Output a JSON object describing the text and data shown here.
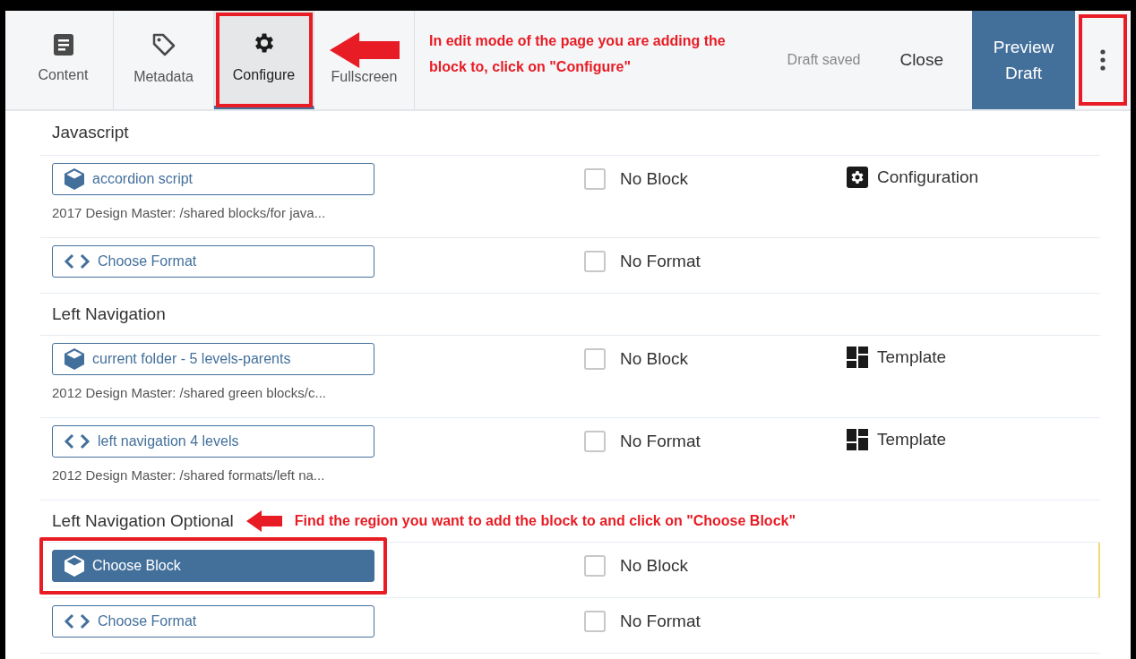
{
  "tabs": [
    {
      "label": "Content",
      "selected": false,
      "annotated": false
    },
    {
      "label": "Metadata",
      "selected": false,
      "annotated": false
    },
    {
      "label": "Configure",
      "selected": true,
      "annotated": true
    },
    {
      "label": "Fullscreen",
      "selected": false,
      "annotated": false
    }
  ],
  "toolbar_annotation": "In edit mode of the page you are adding the block to, click on \"Configure\"",
  "draft_status": "Draft saved",
  "close_button": "Close",
  "preview_button": "Preview Draft",
  "more_menu": {
    "annotated": true
  },
  "sections": [
    {
      "title": "Javascript",
      "rows": [
        {
          "kind": "block",
          "button": {
            "label": "accordion script",
            "selected": false,
            "annotated": false
          },
          "path": "2017 Design Master: /shared blocks/for java...",
          "option": {
            "label": "No Block",
            "checked": false
          },
          "extra": {
            "kind": "configuration",
            "label": "Configuration"
          }
        },
        {
          "kind": "format",
          "button": {
            "label": "Choose Format",
            "selected": false,
            "annotated": false
          },
          "option": {
            "label": "No Format",
            "checked": false
          }
        }
      ]
    },
    {
      "title": "Left Navigation",
      "rows": [
        {
          "kind": "block",
          "button": {
            "label": "current folder - 5 levels-parents",
            "selected": false,
            "annotated": false
          },
          "path": "2012 Design Master: /shared green blocks/c...",
          "option": {
            "label": "No Block",
            "checked": false
          },
          "extra": {
            "kind": "template",
            "label": "Template"
          }
        },
        {
          "kind": "format",
          "button": {
            "label": "left navigation 4 levels",
            "selected": false,
            "annotated": false
          },
          "path": "2012 Design Master: /shared formats/left na...",
          "option": {
            "label": "No Format",
            "checked": false
          },
          "extra": {
            "kind": "template",
            "label": "Template"
          }
        }
      ]
    },
    {
      "title": "Left Navigation Optional",
      "annotation": "Find the region you want to add the block to and click on \"Choose Block\"",
      "rows": [
        {
          "kind": "block",
          "button": {
            "label": "Choose Block",
            "selected": true,
            "annotated": true
          },
          "option": {
            "label": "No Block",
            "checked": false
          }
        },
        {
          "kind": "format",
          "button": {
            "label": "Choose Format",
            "selected": false,
            "annotated": false
          },
          "option": {
            "label": "No Format",
            "checked": false
          }
        }
      ]
    }
  ]
}
